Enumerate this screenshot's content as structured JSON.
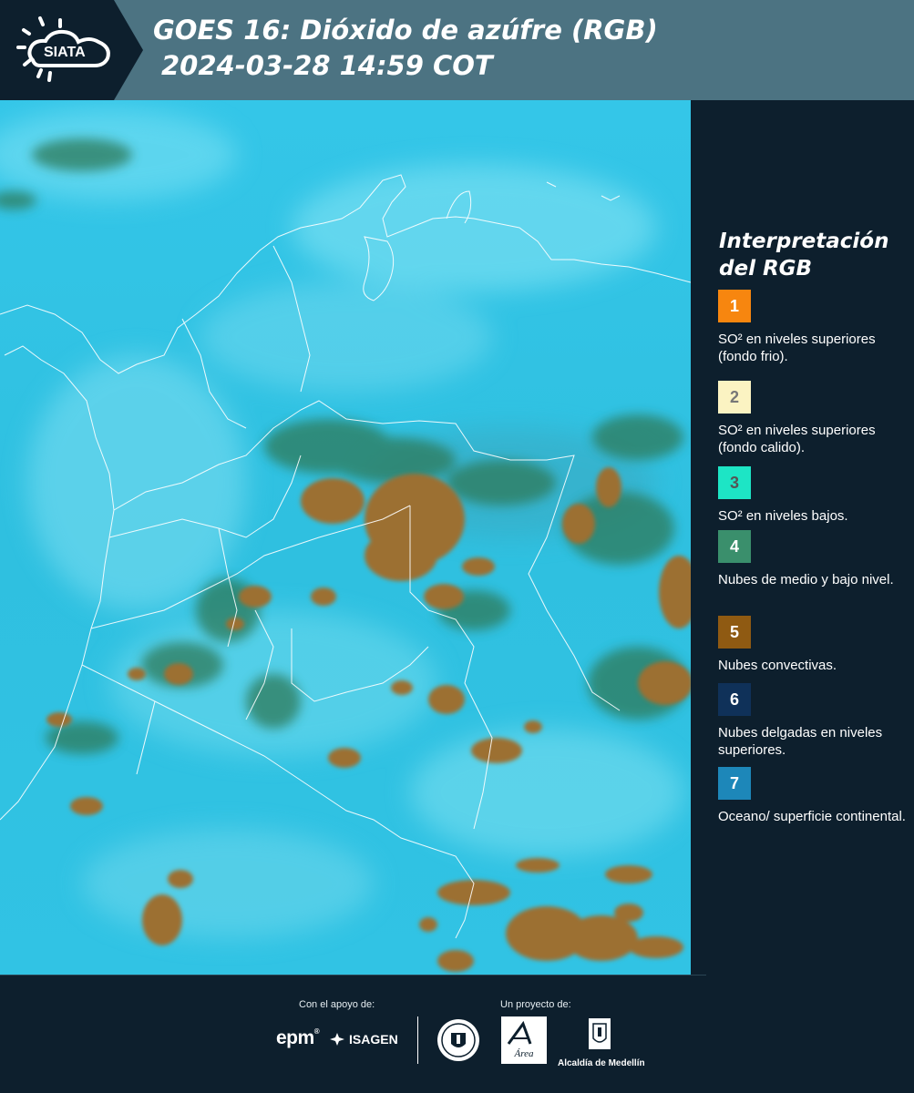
{
  "header": {
    "brand": "SIATA",
    "title_line1": "GOES 16: Dióxido de azúfre (RGB)",
    "title_line2": "2024-03-28 14:59 COT"
  },
  "legend": {
    "title": "Interpretación del RGB",
    "items": [
      {
        "number": "1",
        "color": "#f7860f",
        "text_color": "#ffffff",
        "label": "SO² en niveles superiores (fondo frio)."
      },
      {
        "number": "2",
        "color": "#fbf3c2",
        "text_color": "#777777",
        "label": "SO² en niveles superiores (fondo calido)."
      },
      {
        "number": "3",
        "color": "#1de5c5",
        "text_color": "#555555",
        "label": "SO² en niveles bajos."
      },
      {
        "number": "4",
        "color": "#3a8f6c",
        "text_color": "#ffffff",
        "label": "Nubes de medio y bajo nivel."
      },
      {
        "number": "5",
        "color": "#8f5a12",
        "text_color": "#ffffff",
        "label": "Nubes convectivas."
      },
      {
        "number": "6",
        "color": "#0f3159",
        "text_color": "#ffffff",
        "label": "Nubes delgadas en niveles superiores."
      },
      {
        "number": "7",
        "color": "#1d87b9",
        "text_color": "#ffffff",
        "label": "Oceano/ superficie continental."
      }
    ]
  },
  "footer": {
    "support_label": "Con el apoyo de:",
    "project_label": "Un proyecto de:",
    "epm": "epm",
    "isagen": "ISAGEN",
    "area_metropolitana": "Área",
    "alcaldia": "Alcaldía de Medellín"
  },
  "colors": {
    "header_bg": "#4c7382",
    "panel_bg": "#0d1f2d",
    "map_bg": "#2ec3e6",
    "cloud_convective": "#9c7030",
    "cloud_low": "#2f7a5a"
  }
}
